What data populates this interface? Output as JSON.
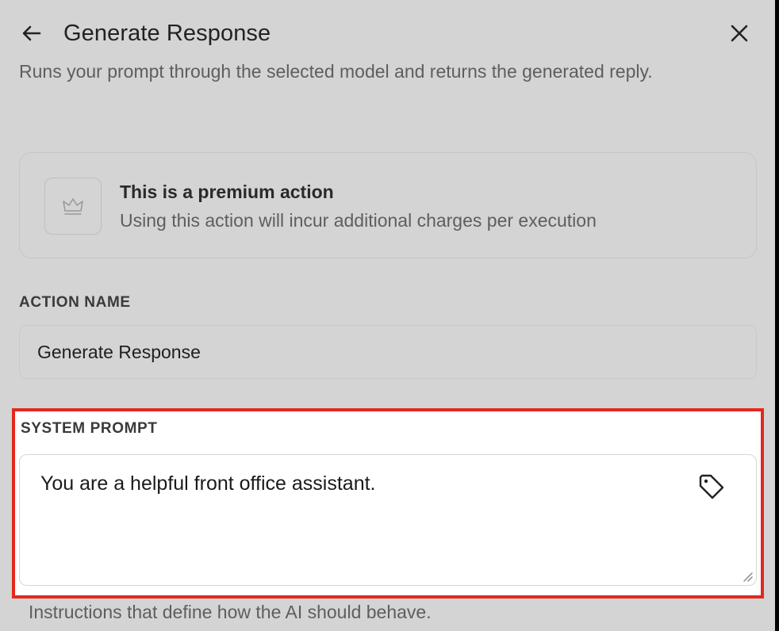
{
  "header": {
    "title": "Generate Response",
    "back_icon": "arrow-left-icon",
    "close_icon": "close-icon"
  },
  "subtitle": "Runs your prompt through the selected model and returns the generated reply.",
  "premium": {
    "icon": "crown-icon",
    "title": "This is a premium action",
    "description": "Using this action will incur additional charges per execution"
  },
  "action_name": {
    "label": "ACTION NAME",
    "value": "Generate Response"
  },
  "system_prompt": {
    "label": "SYSTEM PROMPT",
    "value": "You are a helpful front office assistant.",
    "tag_icon": "tag-icon",
    "help": "Instructions that define how the AI should behave."
  },
  "colors": {
    "background": "#d4d4d4",
    "highlight_border": "#e3281e",
    "prompt_background": "#ffffff"
  }
}
